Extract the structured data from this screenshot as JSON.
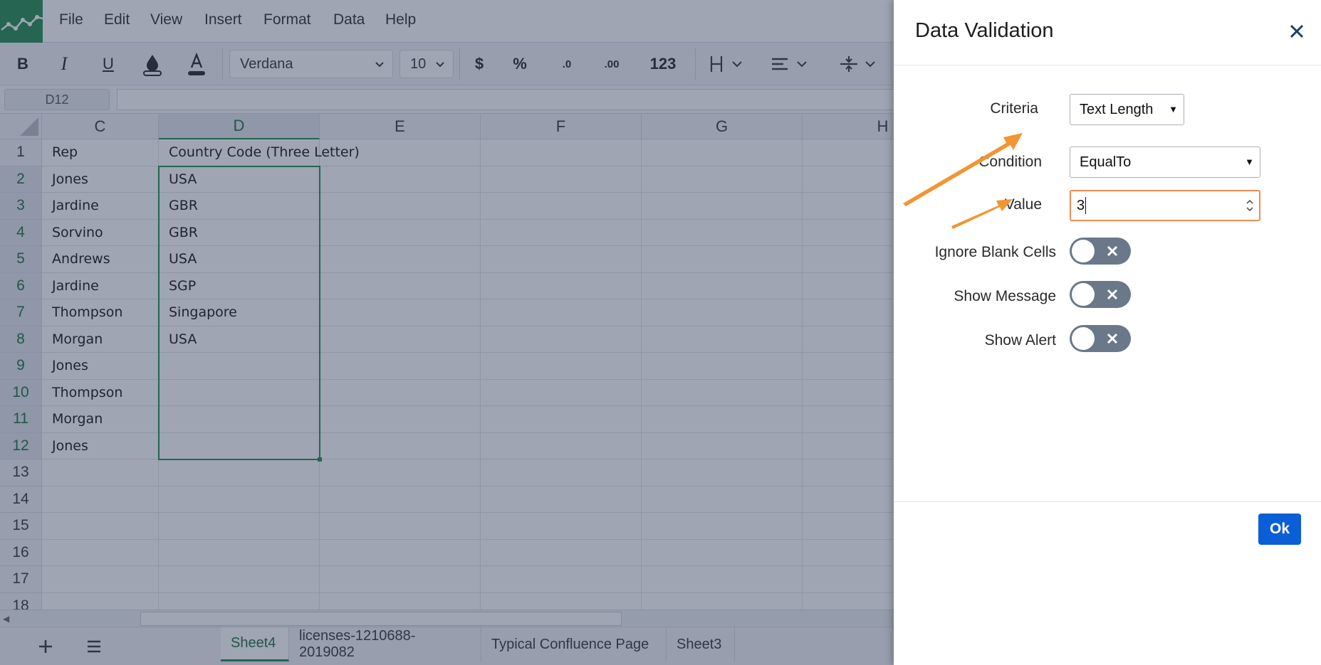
{
  "menu": [
    "File",
    "Edit",
    "View",
    "Insert",
    "Format",
    "Data",
    "Help"
  ],
  "toolbar": {
    "bold": "B",
    "italic": "I",
    "underline": "U",
    "font_name": "Verdana",
    "font_size": "10",
    "currency": "$",
    "percent": "%",
    "decrease_decimal": ".0",
    "increase_decimal": ".00",
    "number_format": "123"
  },
  "formula_bar": {
    "cell_ref": "D12",
    "content": ""
  },
  "columns": [
    "C",
    "D",
    "E",
    "F",
    "G",
    "H"
  ],
  "selected_column": "D",
  "rows": [
    {
      "num": "1",
      "C": "Rep",
      "D": "Country Code (Three Letter)"
    },
    {
      "num": "2",
      "C": "Jones",
      "D": "USA"
    },
    {
      "num": "3",
      "C": "Jardine",
      "D": "GBR"
    },
    {
      "num": "4",
      "C": "Sorvino",
      "D": "GBR"
    },
    {
      "num": "5",
      "C": "Andrews",
      "D": "USA"
    },
    {
      "num": "6",
      "C": "Jardine",
      "D": "SGP"
    },
    {
      "num": "7",
      "C": "Thompson",
      "D": "Singapore"
    },
    {
      "num": "8",
      "C": "Morgan",
      "D": "USA"
    },
    {
      "num": "9",
      "C": "Jones",
      "D": ""
    },
    {
      "num": "10",
      "C": "Thompson",
      "D": ""
    },
    {
      "num": "11",
      "C": "Morgan",
      "D": ""
    },
    {
      "num": "12",
      "C": "Jones",
      "D": ""
    },
    {
      "num": "13",
      "C": "",
      "D": ""
    },
    {
      "num": "14",
      "C": "",
      "D": ""
    },
    {
      "num": "15",
      "C": "",
      "D": ""
    },
    {
      "num": "16",
      "C": "",
      "D": ""
    },
    {
      "num": "17",
      "C": "",
      "D": ""
    },
    {
      "num": "18",
      "C": "",
      "D": ""
    }
  ],
  "sheet_tabs": [
    "Sheet4",
    "licenses-1210688-2019082",
    "Typical Confluence Page",
    "Sheet3"
  ],
  "active_sheet": "Sheet4",
  "dialog": {
    "title": "Data Validation",
    "criteria_label": "Criteria",
    "criteria_value": "Text Length",
    "condition_label": "Condition",
    "condition_value": "EqualTo",
    "value_label": "Value",
    "value": "3",
    "ignore_blank_label": "Ignore Blank Cells",
    "ignore_blank_on": false,
    "show_message_label": "Show Message",
    "show_message_on": false,
    "show_alert_label": "Show Alert",
    "show_alert_on": false,
    "ok_label": "Ok"
  },
  "colors": {
    "brand_green": "#1e8a4b",
    "primary_button": "#0b5fd6",
    "annotation_arrow": "#f29532",
    "focus_border": "#f08a55",
    "toggle_off": "#6b7889"
  }
}
